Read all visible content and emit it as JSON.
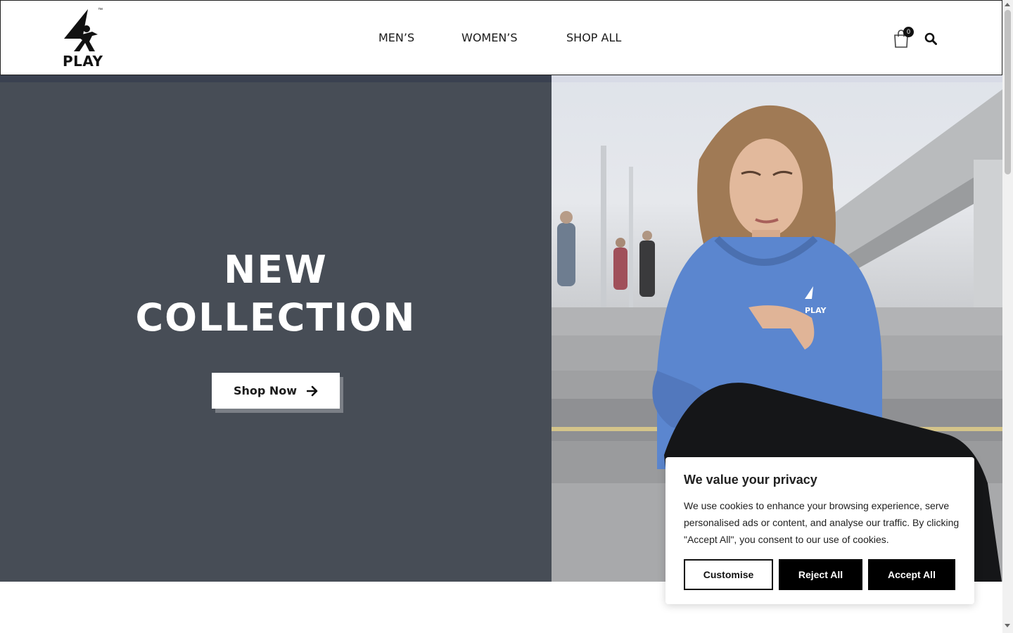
{
  "brand": {
    "logo_text": "PLAY",
    "trademark": "™"
  },
  "nav": {
    "items": [
      {
        "label": "MEN’S"
      },
      {
        "label": "WOMEN’S"
      },
      {
        "label": "SHOP ALL"
      }
    ]
  },
  "cart": {
    "count": "0",
    "icon": "shopping-bag-icon"
  },
  "search": {
    "icon": "search-icon"
  },
  "hero": {
    "title_line1": "NEW",
    "title_line2": "COLLECTION",
    "cta_label": "Shop Now",
    "hoodie_logo": "PLAY",
    "colors": {
      "left_panel": "#474d56",
      "hoodie": "#5b86cf"
    }
  },
  "cookie": {
    "title": "We value your privacy",
    "text": "We use cookies to enhance your browsing experience, serve personalised ads or content, and analyse our traffic. By clicking \"Accept All\", you consent to our use of cookies.",
    "customise": "Customise",
    "reject": "Reject All",
    "accept": "Accept All"
  }
}
